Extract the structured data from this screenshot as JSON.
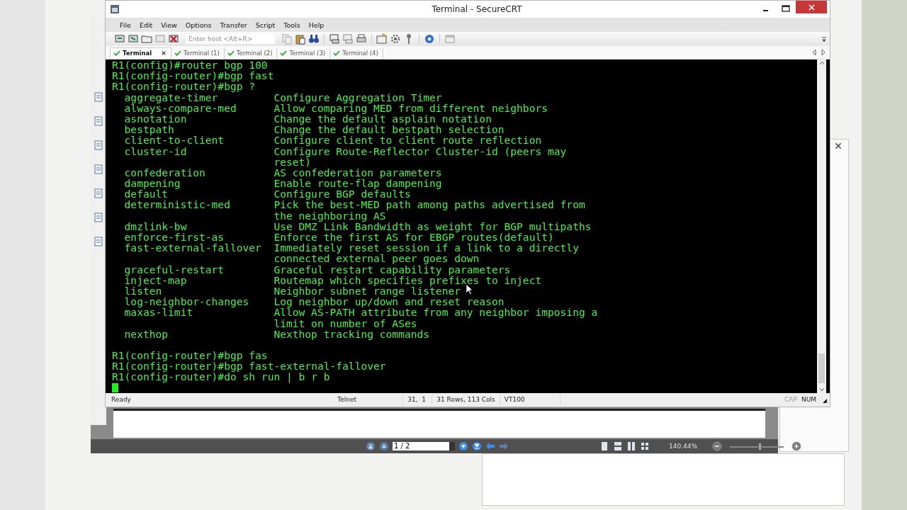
{
  "window": {
    "title": "Terminal - SecureCRT"
  },
  "menu": [
    "File",
    "Edit",
    "View",
    "Options",
    "Transfer",
    "Script",
    "Tools",
    "Help"
  ],
  "host_field": {
    "placeholder": "Enter host <Alt+R>"
  },
  "tabs": [
    {
      "label": "Terminal",
      "selected": true
    },
    {
      "label": "Terminal (1)",
      "selected": false
    },
    {
      "label": "Terminal (2)",
      "selected": false
    },
    {
      "label": "Terminal (3)",
      "selected": false
    },
    {
      "label": "Terminal (4)",
      "selected": false
    }
  ],
  "terminal": {
    "lines_before": [
      "R1(config)#router bgp 100",
      "R1(config-router)#bgp fast",
      "R1(config-router)#bgp ?"
    ],
    "help_rows": [
      {
        "command": "aggregate-timer",
        "description": [
          "Configure Aggregation Timer"
        ]
      },
      {
        "command": "always-compare-med",
        "description": [
          "Allow comparing MED from different neighbors"
        ]
      },
      {
        "command": "asnotation",
        "description": [
          "Change the default asplain notation"
        ]
      },
      {
        "command": "bestpath",
        "description": [
          "Change the default bestpath selection"
        ]
      },
      {
        "command": "client-to-client",
        "description": [
          "Configure client to client route reflection"
        ]
      },
      {
        "command": "cluster-id",
        "description": [
          "Configure Route-Reflector Cluster-id (peers may",
          "reset)"
        ]
      },
      {
        "command": "confederation",
        "description": [
          "AS confederation parameters"
        ]
      },
      {
        "command": "dampening",
        "description": [
          "Enable route-flap dampening"
        ]
      },
      {
        "command": "default",
        "description": [
          "Configure BGP defaults"
        ]
      },
      {
        "command": "deterministic-med",
        "description": [
          "Pick the best-MED path among paths advertised from",
          "the neighboring AS"
        ]
      },
      {
        "command": "dmzlink-bw",
        "description": [
          "Use DMZ Link Bandwidth as weight for BGP multipaths"
        ]
      },
      {
        "command": "enforce-first-as",
        "description": [
          "Enforce the first AS for EBGP routes(default)"
        ]
      },
      {
        "command": "fast-external-fallover",
        "description": [
          "Immediately reset session if a link to a directly",
          "connected external peer goes down"
        ]
      },
      {
        "command": "graceful-restart",
        "description": [
          "Graceful restart capability parameters"
        ]
      },
      {
        "command": "inject-map",
        "description": [
          "Routemap which specifies prefixes to inject"
        ]
      },
      {
        "command": "listen",
        "description": [
          "Neighbor subnet range listener"
        ]
      },
      {
        "command": "log-neighbor-changes",
        "description": [
          "Log neighbor up/down and reset reason"
        ]
      },
      {
        "command": "maxas-limit",
        "description": [
          "Allow AS-PATH attribute from any neighbor imposing a",
          "limit on number of ASes"
        ]
      },
      {
        "command": "nexthop",
        "description": [
          "Nexthop tracking commands"
        ]
      }
    ],
    "lines_after": [
      "R1(config-router)#bgp fas",
      "R1(config-router)#bgp fast-external-fallover",
      "R1(config-router)#do sh run | b r b"
    ]
  },
  "status_bar": {
    "state": "Ready",
    "protocol": "Telnet",
    "position": "31,  1",
    "size": "31 Rows, 113 Cols",
    "emulation": "VT100",
    "indicators": [
      {
        "label": "CAP",
        "on": false
      },
      {
        "label": "NUM",
        "on": true
      }
    ]
  },
  "pdf_viewer": {
    "page_field": "1 / 2",
    "zoom": "140.44%",
    "zoom_slider": {
      "level": 0.55
    }
  }
}
